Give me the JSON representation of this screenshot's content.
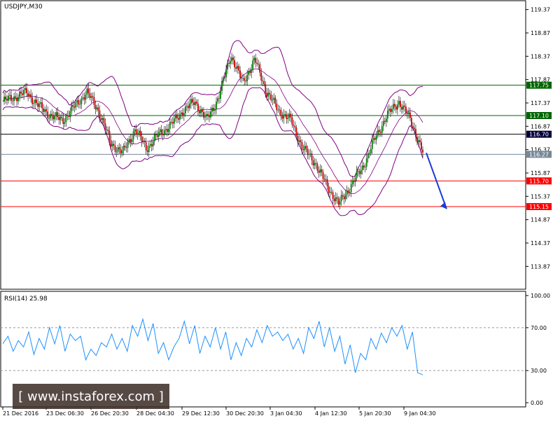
{
  "chart_data": [
    {
      "type": "candlestick",
      "title": "USDJPY,M30",
      "ylim": [
        113.5,
        119.5
      ],
      "y_ticks": [
        "119.37",
        "118.87",
        "118.37",
        "117.87",
        "117.37",
        "116.87",
        "116.37",
        "115.87",
        "115.37",
        "114.87",
        "114.37",
        "113.87"
      ],
      "x_ticks": [
        "21 Dec 2016",
        "23 Dec 06:30",
        "26 Dec 20:30",
        "28 Dec 04:30",
        "29 Dec 12:30",
        "30 Dec 20:30",
        "3 Jan 04:30",
        "4 Jan 12:30",
        "5 Jan 20:30",
        "9 Jan 04:30"
      ],
      "price_line": [
        117.4,
        117.5,
        117.6,
        117.3,
        117.1,
        117.0,
        117.3,
        117.6,
        117.2,
        116.5,
        116.3,
        116.8,
        116.4,
        116.7,
        116.9,
        117.2,
        117.4,
        117.0,
        117.5,
        118.4,
        117.8,
        118.3,
        117.6,
        117.2,
        117.0,
        116.4,
        116.1,
        115.6,
        115.2,
        115.6,
        116.0,
        116.6,
        117.1,
        117.4,
        117.0,
        116.3
      ],
      "horizontal_levels": [
        {
          "value": "117.75",
          "color": "#006400",
          "label_bg": "#006400"
        },
        {
          "value": "117.10",
          "color": "#006400",
          "label_bg": "#006400"
        },
        {
          "value": "116.70",
          "color": "#000000",
          "label_bg": "#00003a"
        },
        {
          "value": "116.27",
          "color": "#778899",
          "label_bg": "#778899"
        },
        {
          "value": "115.70",
          "color": "#ff0000",
          "label_bg": "#ff0000"
        },
        {
          "value": "115.15",
          "color": "#ff0000",
          "label_bg": "#ff0000"
        }
      ],
      "arrow_color": "#1a3bd6"
    },
    {
      "type": "line",
      "title": "RSI(14) 25.98",
      "ylim": [
        0,
        100
      ],
      "y_ticks": [
        "100.00",
        "70.00",
        "30.00",
        "0.00"
      ],
      "levels": [
        70,
        30
      ],
      "values": [
        55,
        62,
        48,
        58,
        52,
        66,
        45,
        60,
        50,
        70,
        55,
        72,
        48,
        64,
        58,
        62,
        40,
        50,
        44,
        56,
        52,
        64,
        50,
        60,
        48,
        72,
        62,
        78,
        58,
        74,
        46,
        56,
        40,
        52,
        60,
        76,
        55,
        72,
        46,
        62,
        52,
        70,
        50,
        66,
        40,
        56,
        44,
        60,
        52,
        68,
        56,
        72,
        62,
        66,
        58,
        64,
        50,
        60,
        46,
        70,
        60,
        76,
        52,
        70,
        48,
        62,
        36,
        54,
        28,
        46,
        40,
        60,
        50,
        65,
        56,
        70,
        62,
        72,
        50,
        66,
        28,
        26
      ]
    }
  ],
  "watermark": "[ www.instaforex.com ]"
}
